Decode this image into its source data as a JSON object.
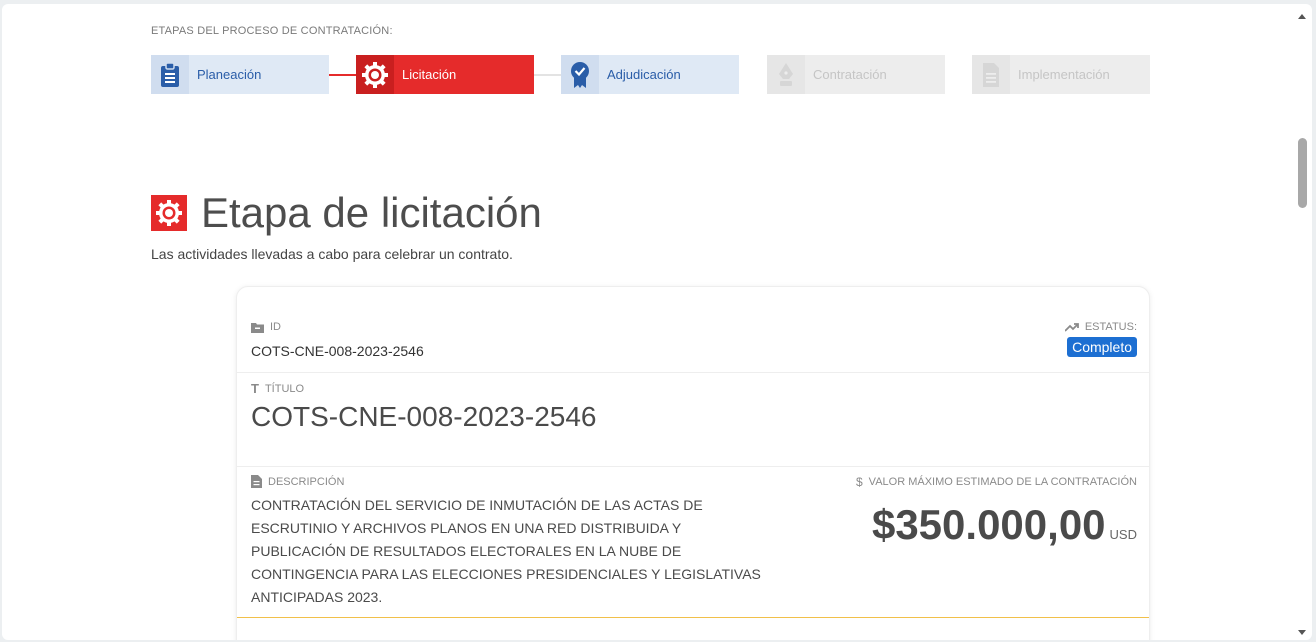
{
  "stages": {
    "label": "ETAPAS DEL PROCESO DE CONTRATACIÓN:",
    "items": [
      {
        "label": "Planeación",
        "icon": "clipboard-icon",
        "state": "done"
      },
      {
        "label": "Licitación",
        "icon": "gear-icon",
        "state": "active"
      },
      {
        "label": "Adjudicación",
        "icon": "award-badge-icon",
        "state": "done"
      },
      {
        "label": "Contratación",
        "icon": "pen-nib-icon",
        "state": "disabled"
      },
      {
        "label": "Implementación",
        "icon": "document-icon",
        "state": "disabled"
      }
    ]
  },
  "page": {
    "title": "Etapa de licitación",
    "subtitle": "Las actividades llevadas a cabo para celebrar un contrato."
  },
  "card": {
    "id_label": "ID",
    "id_value": "COTS-CNE-008-2023-2546",
    "status_label": "ESTATUS:",
    "status_value": "Completo",
    "title_label": "TÍTULO",
    "title_value": "COTS-CNE-008-2023-2546",
    "description_label": "DESCRIPCIÓN",
    "description_value": "CONTRATACIÓN DEL SERVICIO DE INMUTACIÓN DE LAS ACTAS DE ESCRUTINIO Y ARCHIVOS PLANOS EN UNA RED DISTRIBUIDA Y PUBLICACIÓN DE RESULTADOS ELECTORALES EN LA NUBE DE CONTINGENCIA PARA LAS ELECCIONES PRESIDENCIALES Y LEGISLATIVAS ANTICIPADAS 2023.",
    "value_label": "VALOR MÁXIMO ESTIMADO DE LA CONTRATACIÓN",
    "value_amount": "$350.000,00",
    "value_currency": "USD"
  },
  "colors": {
    "accent_red": "#e52b2b",
    "accent_blue": "#2a5da8",
    "badge_blue": "#1d6fd2",
    "divider_gold": "#f1c04a"
  }
}
